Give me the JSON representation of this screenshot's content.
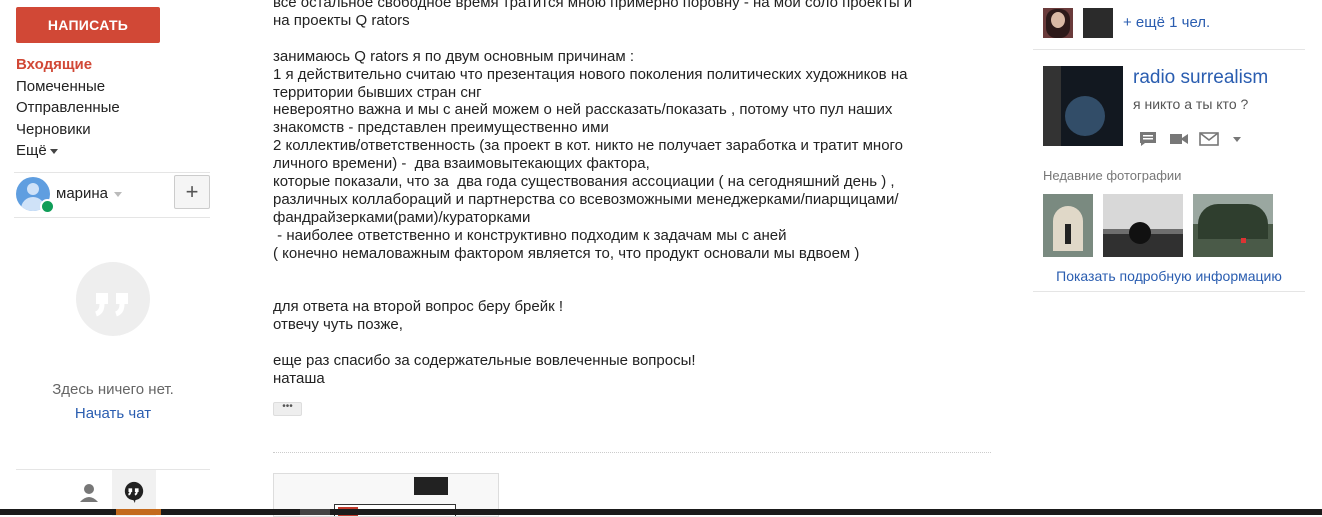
{
  "left_nav": {
    "compose_label": "НАПИСАТЬ",
    "items": [
      {
        "label": "Входящие",
        "active": true
      },
      {
        "label": "Помеченные"
      },
      {
        "label": "Отправленные"
      },
      {
        "label": "Черновики"
      },
      {
        "label": "Ещё"
      }
    ]
  },
  "chat": {
    "user_name": "марина",
    "empty_text": "Здесь ничего нет.",
    "start_chat_label": "Начать чат"
  },
  "message": {
    "lines": [
      "все остальное свободное время тратится мною примерно поровну - на мои соло проекты и",
      "на проекты Q rators",
      "",
      "занимаюсь Q rators я по двум основным причинам :",
      "1 я действительно считаю что презентация нового поколения политических художников на",
      "территории бывших стран снг",
      "невероятно важна и мы с аней можем о ней рассказать/показать , потому что пул наших",
      "знакомств - представлен преимущественно ими",
      "2 коллектив/ответственность (за проект в кот. никто не получает заработка и тратит много",
      "личного времени) -  два взаимовытекающих фактора,",
      "которые показали, что за  два года существования ассоциации ( на сегодняшний день ) ,",
      "различных коллабораций и партнерства со всевозможными менеджерками/пиарщицами/",
      "фандрайзерками(рами)/кураторками",
      " - наиболее ответственно и конструктивно подходим к задачам мы с аней",
      "( конечно немаловажным фактором является то, что продукт основали мы вдвоем )",
      "",
      "",
      "для ответа на второй вопрос беру брейк !",
      "отвечу чуть позже,",
      "",
      "еще раз спасибо за содержательные вовлеченные вопросы!",
      "наташа"
    ],
    "show_trimmed_label": "•••"
  },
  "right_panel": {
    "more_people_label": "+ ещё 1 чел.",
    "contact": {
      "name": "radio surrealism",
      "status": "я никто а ты кто ?"
    },
    "recent_photos_label": "Недавние фотографии",
    "details_link": "Показать подробную информацию"
  },
  "colors": {
    "compose_bg": "#d14836",
    "link": "#2a5db0",
    "active_nav": "#d14836",
    "online": "#0f9d58"
  },
  "icons": [
    "caret-down-icon",
    "plus-icon",
    "hangouts-quote-icon",
    "person-icon",
    "hangouts-icon",
    "chat-icon",
    "video-icon",
    "mail-icon"
  ]
}
